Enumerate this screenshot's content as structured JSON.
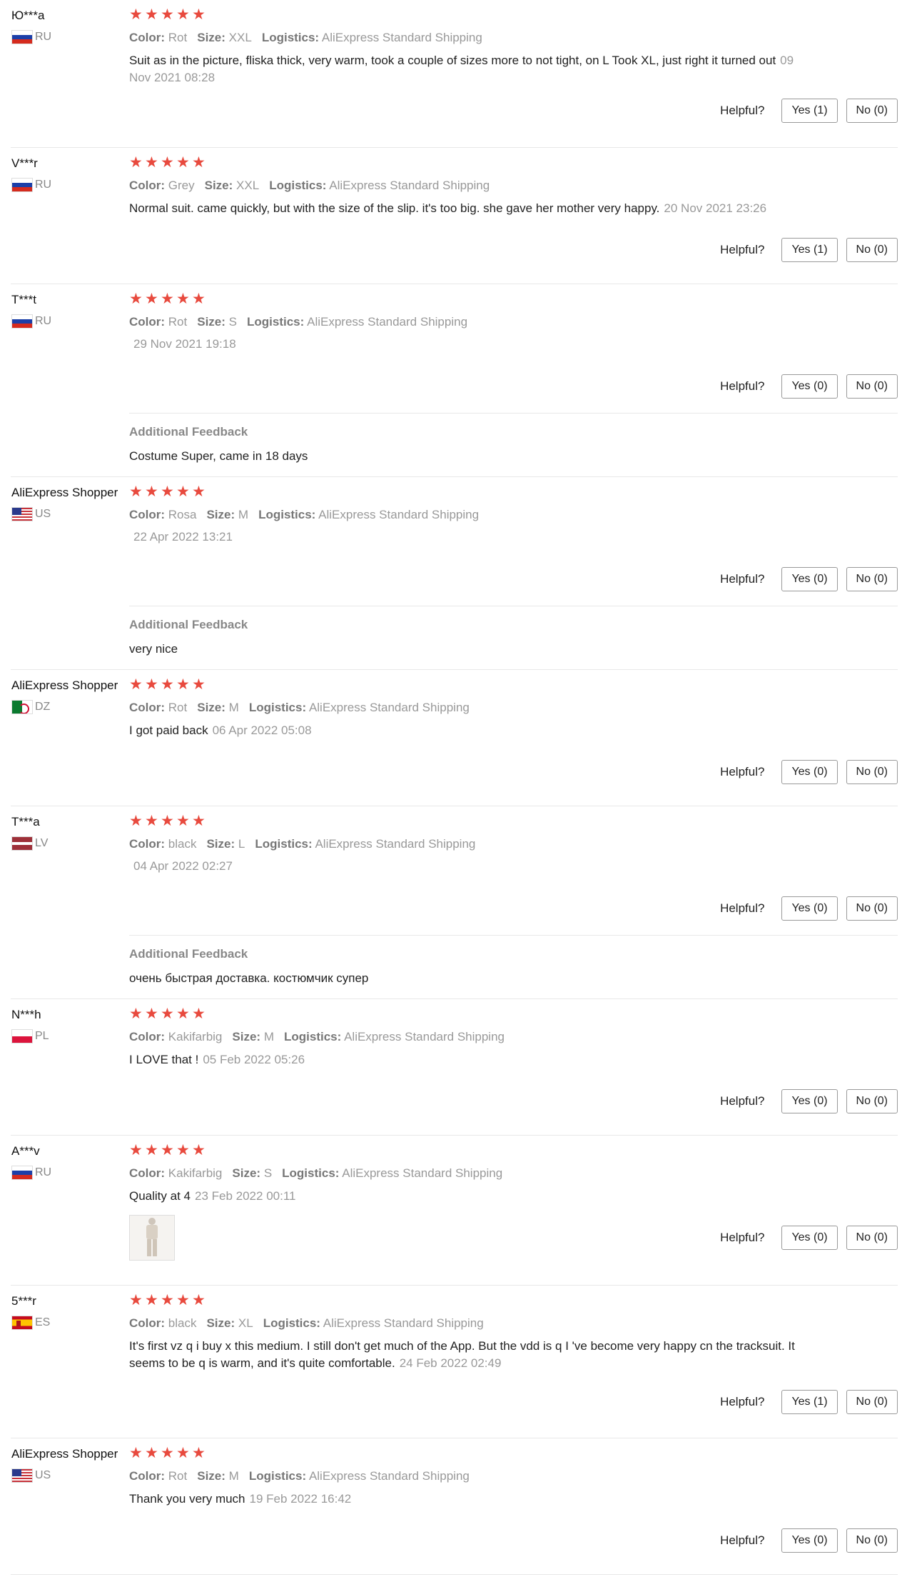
{
  "labels": {
    "color": "Color:",
    "size": "Size:",
    "logistics": "Logistics:",
    "helpful": "Helpful?",
    "additional_feedback": "Additional Feedback"
  },
  "reviews": [
    {
      "user": "Ю***a",
      "country": "RU",
      "flag": "ru",
      "rating": 5,
      "color": "Rot",
      "size": "XXL",
      "logistics": "AliExpress Standard Shipping",
      "text": "Suit as in the picture, fliska thick, very warm, took a couple of sizes more to not tight, on L Took XL, just right it turned out",
      "date": "09 Nov 2021 08:28",
      "yes": "Yes (1)",
      "no": "No (0)"
    },
    {
      "user": "V***r",
      "country": "RU",
      "flag": "ru",
      "rating": 5,
      "color": "Grey",
      "size": "XXL",
      "logistics": "AliExpress Standard Shipping",
      "text": "Normal suit. came quickly, but with the size of the slip. it's too big. she gave her mother very happy.",
      "date": "20 Nov 2021 23:26",
      "yes": "Yes (1)",
      "no": "No (0)"
    },
    {
      "user": "T***t",
      "country": "RU",
      "flag": "ru",
      "rating": 5,
      "color": "Rot",
      "size": "S",
      "logistics": "AliExpress Standard Shipping",
      "text": "",
      "date": "29 Nov 2021 19:18",
      "yes": "Yes (0)",
      "no": "No (0)",
      "additional": "Costume Super, came in 18 days"
    },
    {
      "user": "AliExpress Shopper",
      "country": "US",
      "flag": "us",
      "rating": 5,
      "color": "Rosa",
      "size": "M",
      "logistics": "AliExpress Standard Shipping",
      "text": "",
      "date": "22 Apr 2022 13:21",
      "yes": "Yes (0)",
      "no": "No (0)",
      "additional": "very nice"
    },
    {
      "user": "AliExpress Shopper",
      "country": "DZ",
      "flag": "dz",
      "rating": 5,
      "color": "Rot",
      "size": "M",
      "logistics": "AliExpress Standard Shipping",
      "text": "I got paid back",
      "date": "06 Apr 2022 05:08",
      "yes": "Yes (0)",
      "no": "No (0)"
    },
    {
      "user": "T***a",
      "country": "LV",
      "flag": "lv",
      "rating": 5,
      "color": "black",
      "size": "L",
      "logistics": "AliExpress Standard Shipping",
      "text": "",
      "date": "04 Apr 2022 02:27",
      "yes": "Yes (0)",
      "no": "No (0)",
      "additional": "очень быстрая доставка. костюмчик супер"
    },
    {
      "user": "N***h",
      "country": "PL",
      "flag": "pl",
      "rating": 5,
      "color": "Kakifarbig",
      "size": "M",
      "logistics": "AliExpress Standard Shipping",
      "text": "I LOVE that !",
      "date": "05 Feb 2022 05:26",
      "yes": "Yes (0)",
      "no": "No (0)"
    },
    {
      "user": "A***v",
      "country": "RU",
      "flag": "ru",
      "rating": 5,
      "color": "Kakifarbig",
      "size": "S",
      "logistics": "AliExpress Standard Shipping",
      "text": "Quality at 4",
      "date": "23 Feb 2022 00:11",
      "yes": "Yes (0)",
      "no": "No (0)",
      "has_photo": true
    },
    {
      "user": "5***r",
      "country": "ES",
      "flag": "es",
      "rating": 5,
      "color": "black",
      "size": "XL",
      "logistics": "AliExpress Standard Shipping",
      "text": "It's first vz q i buy x this medium. I still don't get much of the App. But the vdd is q I 've become very happy cn the tracksuit. It seems to be q is warm, and it's quite comfortable.",
      "date": "24 Feb 2022 02:49",
      "yes": "Yes (1)",
      "no": "No (0)"
    },
    {
      "user": "AliExpress Shopper",
      "country": "US",
      "flag": "us",
      "rating": 5,
      "color": "Rot",
      "size": "M",
      "logistics": "AliExpress Standard Shipping",
      "text": "Thank you very much",
      "date": "19 Feb 2022 16:42",
      "yes": "Yes (0)",
      "no": "No (0)"
    }
  ]
}
